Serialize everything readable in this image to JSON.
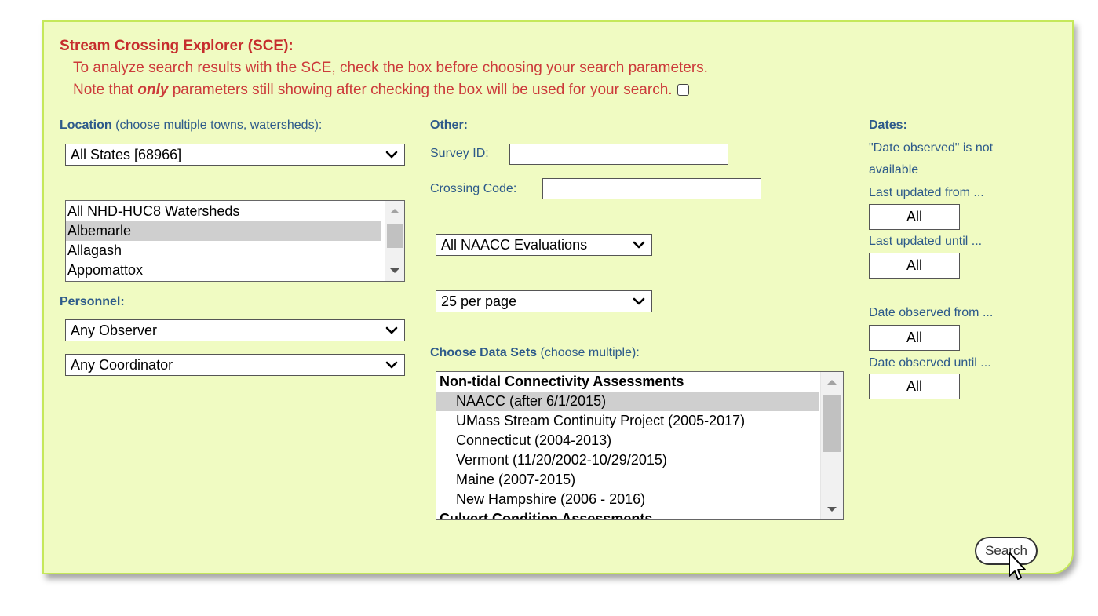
{
  "sce": {
    "title": "Stream Crossing Explorer (SCE):",
    "line1": "To analyze search results with the SCE, check the box before choosing your search parameters.",
    "line2_pre": "Note that ",
    "line2_em": "only",
    "line2_post": " parameters still showing after checking the box will be used for your search.",
    "checked": false
  },
  "location": {
    "label": "Location",
    "hint": " (choose multiple towns, watersheds):",
    "state_select": "All States [68966]",
    "watersheds": [
      "All NHD-HUC8 Watersheds",
      "Albemarle",
      "Allagash",
      "Appomattox"
    ],
    "selected_watershed": "Albemarle"
  },
  "personnel": {
    "label": "Personnel:",
    "observer_select": "Any Observer",
    "coordinator_select": "Any Coordinator"
  },
  "other": {
    "label": "Other:",
    "survey_id_label": "Survey ID:",
    "survey_id_value": "",
    "crossing_code_label": "Crossing Code:",
    "crossing_code_value": "",
    "evaluations_select": "All NAACC Evaluations",
    "per_page_select": "25 per page"
  },
  "datasets": {
    "label": "Choose Data Sets",
    "hint": " (choose multiple):",
    "group1": "Non-tidal Connectivity Assessments",
    "items": [
      "NAACC (after 6/1/2015)",
      "UMass Stream Continuity Project (2005-2017)",
      "Connecticut (2004-2013)",
      "Vermont (11/20/2002-10/29/2015)",
      "Maine (2007-2015)",
      "New Hampshire (2006 - 2016)"
    ],
    "group2": "Culvert Condition Assessments",
    "selected": "NAACC (after 6/1/2015)"
  },
  "dates": {
    "label": "Dates:",
    "note_line1": "\"Date observed\" is not",
    "note_line2": "available",
    "last_updated_from": "Last updated from ...",
    "last_updated_from_value": "All",
    "last_updated_until": "Last updated until ...",
    "last_updated_until_value": "All",
    "observed_from": "Date observed from ...",
    "observed_from_value": "All",
    "observed_until": "Date observed until ...",
    "observed_until_value": "All"
  },
  "search_button": "Search",
  "colors": {
    "panel_bg": "#f0fbc2",
    "panel_border": "#c5e85a",
    "sce_red": "#c62d2d",
    "label_blue": "#2d5a8a"
  }
}
